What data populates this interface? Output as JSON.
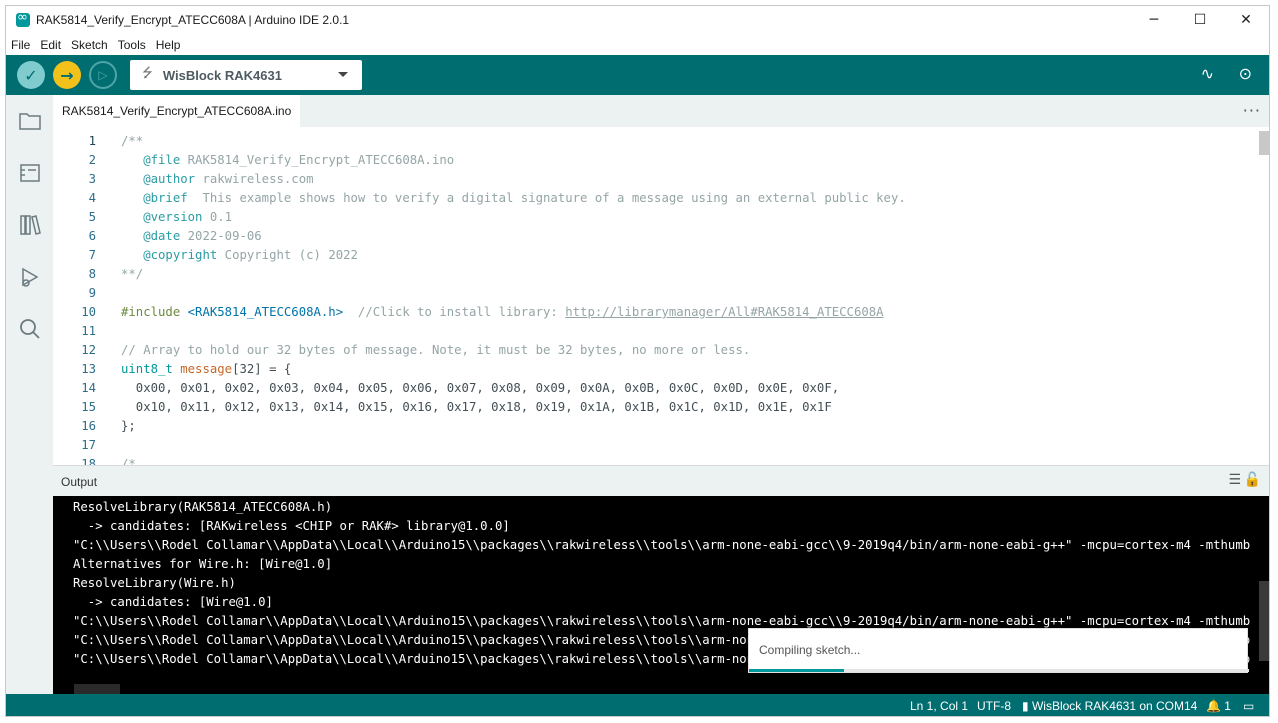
{
  "window": {
    "title": "RAK5814_Verify_Encrypt_ATECC608A | Arduino IDE 2.0.1",
    "controls": {
      "minimize": "─",
      "maximize": "☐",
      "close": "✕"
    }
  },
  "menu": [
    "File",
    "Edit",
    "Sketch",
    "Tools",
    "Help"
  ],
  "toolbar": {
    "verify_icon": "✓",
    "upload_icon": "→",
    "debug_icon": "▷",
    "board": "WisBlock RAK4631",
    "usb_icon": "⭍",
    "serial_plotter_icon": "∿",
    "serial_monitor_icon": "⊙"
  },
  "tab": {
    "name": "RAK5814_Verify_Encrypt_ATECC608A.ino",
    "more": "···"
  },
  "editor": {
    "lines": [
      {
        "n": "1",
        "parts": [
          {
            "c": "c-comment",
            "t": "/**"
          }
        ]
      },
      {
        "n": "2",
        "parts": [
          {
            "c": "c-comment",
            "t": "   "
          },
          {
            "c": "c-tag",
            "t": "@file"
          },
          {
            "c": "c-comment",
            "t": " RAK5814_Verify_Encrypt_ATECC608A.ino"
          }
        ]
      },
      {
        "n": "3",
        "parts": [
          {
            "c": "c-comment",
            "t": "   "
          },
          {
            "c": "c-tag",
            "t": "@author"
          },
          {
            "c": "c-comment",
            "t": " rakwireless.com"
          }
        ]
      },
      {
        "n": "4",
        "parts": [
          {
            "c": "c-comment",
            "t": "   "
          },
          {
            "c": "c-tag",
            "t": "@brief"
          },
          {
            "c": "c-comment",
            "t": "  This example shows how to verify a digital signature of a message using an external public key."
          }
        ]
      },
      {
        "n": "5",
        "parts": [
          {
            "c": "c-comment",
            "t": "   "
          },
          {
            "c": "c-tag",
            "t": "@version"
          },
          {
            "c": "c-comment",
            "t": " 0.1"
          }
        ]
      },
      {
        "n": "6",
        "parts": [
          {
            "c": "c-comment",
            "t": "   "
          },
          {
            "c": "c-tag",
            "t": "@date"
          },
          {
            "c": "c-comment",
            "t": " 2022-09-06"
          }
        ]
      },
      {
        "n": "7",
        "parts": [
          {
            "c": "c-comment",
            "t": "   "
          },
          {
            "c": "c-tag",
            "t": "@copyright"
          },
          {
            "c": "c-comment",
            "t": " Copyright (c) 2022"
          }
        ]
      },
      {
        "n": "8",
        "parts": [
          {
            "c": "c-comment",
            "t": "**/"
          }
        ]
      },
      {
        "n": "9",
        "parts": []
      },
      {
        "n": "10",
        "parts": [
          {
            "c": "c-pre",
            "t": "#include"
          },
          {
            "c": "c-plain",
            "t": " "
          },
          {
            "c": "c-str",
            "t": "<RAK5814_ATECC608A.h>"
          },
          {
            "c": "c-comment",
            "t": "  //Click to install library: "
          },
          {
            "c": "c-link",
            "t": "http://librarymanager/All#RAK5814_ATECC608A"
          }
        ]
      },
      {
        "n": "11",
        "parts": []
      },
      {
        "n": "12",
        "parts": [
          {
            "c": "c-comment",
            "t": "// Array to hold our 32 bytes of message. Note, it must be 32 bytes, no more or less."
          }
        ]
      },
      {
        "n": "13",
        "parts": [
          {
            "c": "c-type",
            "t": "uint8_t"
          },
          {
            "c": "c-plain",
            "t": " "
          },
          {
            "c": "c-var",
            "t": "message"
          },
          {
            "c": "c-plain",
            "t": "[32] = {"
          }
        ]
      },
      {
        "n": "14",
        "parts": [
          {
            "c": "c-plain",
            "t": "  0x00, 0x01, 0x02, 0x03, 0x04, 0x05, 0x06, 0x07, 0x08, 0x09, 0x0A, 0x0B, 0x0C, 0x0D, 0x0E, 0x0F,"
          }
        ]
      },
      {
        "n": "15",
        "parts": [
          {
            "c": "c-plain",
            "t": "  0x10, 0x11, 0x12, 0x13, 0x14, 0x15, 0x16, 0x17, 0x18, 0x19, 0x1A, 0x1B, 0x1C, 0x1D, 0x1E, 0x1F"
          }
        ]
      },
      {
        "n": "16",
        "parts": [
          {
            "c": "c-plain",
            "t": "};"
          }
        ]
      },
      {
        "n": "17",
        "parts": []
      },
      {
        "n": "18",
        "parts": [
          {
            "c": "c-comment",
            "t": "/*"
          }
        ]
      }
    ]
  },
  "output": {
    "title": "Output",
    "clear_icon": "☰",
    "lock_icon": "🔓",
    "lines": [
      "ResolveLibrary(RAK5814_ATECC608A.h)",
      "  -> candidates: [RAKwireless <CHIP or RAK#> library@1.0.0]",
      "\"C:\\\\Users\\\\Rodel Collamar\\\\AppData\\\\Local\\\\Arduino15\\\\packages\\\\rakwireless\\\\tools\\\\arm-none-eabi-gcc\\\\9-2019q4/bin/arm-none-eabi-g++\" -mcpu=cortex-m4 -mthumb",
      "Alternatives for Wire.h: [Wire@1.0]",
      "ResolveLibrary(Wire.h)",
      "  -> candidates: [Wire@1.0]",
      "\"C:\\\\Users\\\\Rodel Collamar\\\\AppData\\\\Local\\\\Arduino15\\\\packages\\\\rakwireless\\\\tools\\\\arm-none-eabi-gcc\\\\9-2019q4/bin/arm-none-eabi-g++\" -mcpu=cortex-m4 -mthumb",
      "\"C:\\\\Users\\\\Rodel Collamar\\\\AppData\\\\Local\\\\Arduino15\\\\packages\\\\rakwireless\\\\tools\\\\arm-none-eabi-gcc\\\\9-2019q4/bin/arm-none-eabi-g++\" -mcpu=cortex-m4 -mthumb",
      "\"C:\\\\Users\\\\Rodel Collamar\\\\AppData\\\\Local\\\\Arduino15\\\\packages\\\\rakwireless\\\\tools\\\\arm-none-eabi-gcc\\\\9-2019q4/bin/arm-none-eabi-g++\" -mcpu=cortex-m4 -mthumb"
    ]
  },
  "toast": {
    "message": "Compiling sketch...",
    "progress": 0.19
  },
  "status": {
    "position": "Ln 1, Col 1",
    "encoding": "UTF-8",
    "board_port": "WisBlock RAK4631 on COM14",
    "board_icon": "▮",
    "notifications": "1",
    "notif_icon": "🔔",
    "panel_icon": "▭"
  },
  "colors": {
    "toolbar": "#006d70",
    "accent": "#00979d",
    "upload": "#f3c21a"
  }
}
